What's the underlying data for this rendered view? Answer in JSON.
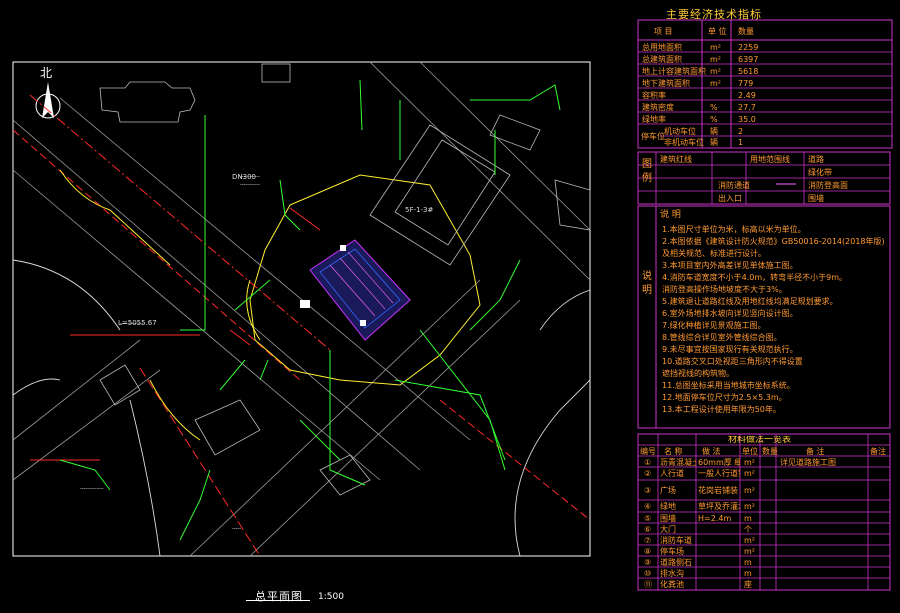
{
  "drawing": {
    "caption": "总平面图",
    "scale": "1:500",
    "north_label": "北"
  },
  "site_labels": {
    "road_upper": "DN300",
    "building_text": "5F-1-3#",
    "label_left": "L=5055.67"
  },
  "tech_table": {
    "title": "主要经济技术指标",
    "headers": [
      "项 目",
      "单 位",
      "数量"
    ],
    "rows": [
      {
        "name": "总用地面积",
        "unit": "m²",
        "value": "2259"
      },
      {
        "name": "总建筑面积",
        "unit": "m²",
        "value": "6397"
      },
      {
        "name": "地上计容建筑面积",
        "unit": "m²",
        "value": "5618"
      },
      {
        "name": "地下建筑面积",
        "unit": "m²",
        "value": "779"
      },
      {
        "name": "容积率",
        "unit": "",
        "value": "2.49"
      },
      {
        "name": "建筑密度",
        "unit": "%",
        "value": "27.7"
      },
      {
        "name": "绿地率",
        "unit": "%",
        "value": "35.0"
      },
      {
        "name": "机动车位",
        "unit": "辆",
        "value": "2"
      },
      {
        "name": "非机动车位",
        "unit": "辆",
        "value": "1"
      }
    ],
    "parking_group": "停车位"
  },
  "legend": {
    "side_label": "图例",
    "items": [
      "建筑红线",
      "用地范围线",
      "道路",
      "绿化带",
      "消防通道",
      "消防登高面",
      "出入口",
      "围墙"
    ]
  },
  "notes": {
    "side_label": "说明",
    "heading": "说 明",
    "lines": [
      "1.本图尺寸单位为米，标高以米为单位。",
      "2.本图依据《建筑设计防火规范》GB50016-2014(2018年版)",
      "  及相关规范、标准进行设计。",
      "3.本项目室内外高差详见单体施工图。",
      "4.消防车道宽度不小于4.0m，转弯半径不小于9m。",
      "  消防登高操作场地坡度不大于3%。",
      "5.建筑退让道路红线及用地红线均满足规划要求。",
      "6.室外场地排水坡向详见竖向设计图。",
      "7.绿化种植详见景观施工图。",
      "8.管线综合详见室外管线综合图。",
      "9.未尽事宜按国家现行有关规范执行。",
      "10.道路交叉口处视距三角形内不得设置",
      "   遮挡视线的构筑物。",
      "11.总图坐标采用当地城市坐标系统。",
      "12.地面停车位尺寸为2.5×5.3m。",
      "13.本工程设计使用年限为50年。"
    ]
  },
  "materials_table": {
    "title": "材料做法一览表",
    "headers": [
      "编号",
      "名 称",
      "做 法",
      "单位",
      "数量",
      "备 注",
      "备注"
    ],
    "rows": [
      [
        "①",
        "沥青混凝土路面",
        "60mm厚 细粒式",
        "m²",
        "",
        "详见道路施工图",
        ""
      ],
      [
        "②",
        "人行道",
        "一般人行道铺装",
        "m²",
        "",
        "",
        ""
      ],
      [
        "③",
        "广场",
        "花岗岩铺装",
        "m²",
        "",
        "",
        ""
      ],
      [
        "④",
        "绿地",
        "草坪及乔灌木",
        "m²",
        "",
        "",
        ""
      ],
      [
        "⑤",
        "围墙",
        "H=2.4m",
        "m",
        "",
        "",
        ""
      ],
      [
        "⑥",
        "大门",
        "",
        "个",
        "",
        "",
        ""
      ],
      [
        "⑦",
        "消防车道",
        "",
        "m²",
        "",
        "",
        ""
      ],
      [
        "⑧",
        "停车场",
        "",
        "m²",
        "",
        "",
        ""
      ],
      [
        "⑨",
        "道路侧石",
        "",
        "m",
        "",
        "",
        ""
      ],
      [
        "⑩",
        "排水沟",
        "",
        "m",
        "",
        "",
        ""
      ],
      [
        "⑪",
        "化粪池",
        "",
        "座",
        "",
        "",
        ""
      ],
      [
        "⑫",
        "污水检查井",
        "",
        "座",
        "",
        "",
        ""
      ]
    ]
  }
}
